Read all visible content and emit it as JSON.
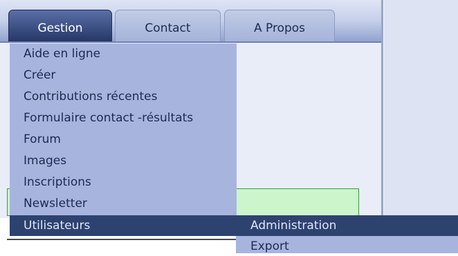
{
  "tabs": [
    {
      "label": "Gestion",
      "active": true
    },
    {
      "label": "Contact",
      "active": false
    },
    {
      "label": "A Propos",
      "active": false
    }
  ],
  "menu": {
    "items": [
      {
        "label": "Aide en ligne"
      },
      {
        "label": "Créer"
      },
      {
        "label": "Contributions récentes"
      },
      {
        "label": "Formulaire contact -résultats"
      },
      {
        "label": "Forum"
      },
      {
        "label": "Images"
      },
      {
        "label": "Inscriptions"
      },
      {
        "label": "Newsletter"
      },
      {
        "label": "Utilisateurs",
        "highlighted": true
      }
    ]
  },
  "submenu": {
    "items": [
      {
        "label": "Administration",
        "highlighted": true
      },
      {
        "label": "Export"
      }
    ]
  },
  "colors": {
    "active_tab": "#253766",
    "menu_bg": "#a7b5de",
    "highlight_bg": "#2e426f",
    "green_box": "#ccf5cc"
  }
}
